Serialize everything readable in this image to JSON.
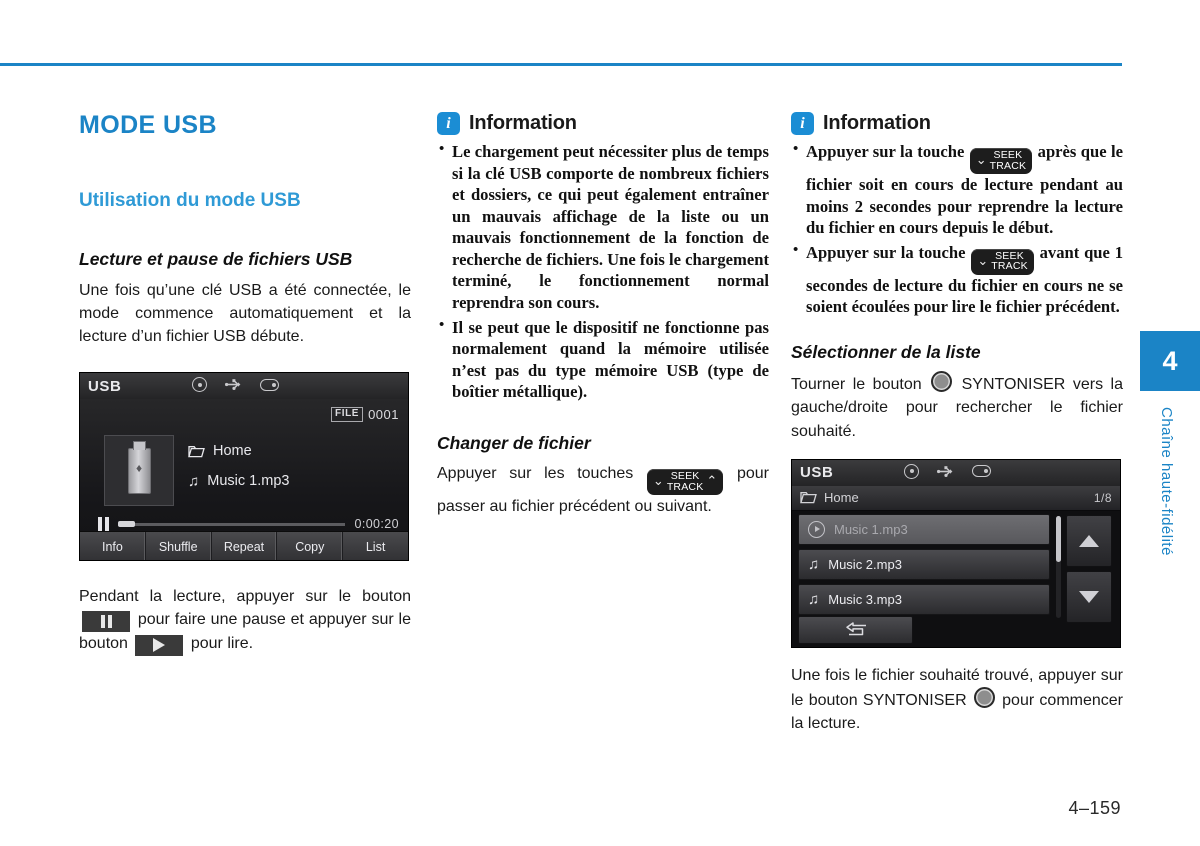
{
  "page": {
    "number": "4–159",
    "accent_color": "#1b84c6"
  },
  "side_tab": {
    "chapter_number": "4",
    "chapter_label": "Chaîne haute-fidélité"
  },
  "left_column": {
    "mode_title": "MODE USB",
    "section_title": "Utilisation du mode USB",
    "subsection_title": "Lecture et pause de fichiers USB",
    "intro_paragraph": "Une fois qu’une clé USB a été connectée, le mode commence automatiquement et la lecture d’un fichier USB débute.",
    "after_paragraph_1": "Pendant la lecture, appuyer sur le bouton",
    "after_paragraph_2": "pour faire une pause et appuyer sur le bouton",
    "after_paragraph_3": "pour lire."
  },
  "player_screen": {
    "source_label": "USB",
    "icons": [
      "disc-icon",
      "usb-icon",
      "aux-device-icon"
    ],
    "file_tag": "FILE",
    "file_number": "0001",
    "folder_name": "Home",
    "track_name": "Music 1.mp3",
    "elapsed_time": "0:00:20",
    "transport_state": "pause-icon",
    "soft_keys": [
      "Info",
      "Shuffle",
      "Repeat",
      "Copy",
      "List"
    ]
  },
  "middle_column": {
    "info_title": "Information",
    "info_items": [
      "Le chargement peut nécessiter plus de temps si la clé USB comporte de nombreux fichiers et dossiers, ce qui peut également entraîner un mauvais affichage de la liste ou un mauvais fonctionnement de la fonction de recherche de fichiers. Une fois le chargement terminé, le fonctionnement normal reprendra son cours.",
      "Il se peut que le dispositif ne fonctionne pas normalement quand la mémoire utilisée n’est pas du type mémoire USB (type de boîtier métallique)."
    ],
    "change_file_title": "Changer de fichier",
    "change_file_text_1": "Appuyer sur les touches",
    "change_file_text_2": "pour passer au fichier précédent ou suivant."
  },
  "right_column": {
    "info_title": "Information",
    "info_item_1_before": "Appuyer sur la touche",
    "info_item_1_after": "après que le fichier soit en cours de lecture pendant au moins 2 secondes pour reprendre la lecture du fichier en cours depuis le début.",
    "info_item_2_before": "Appuyer sur la touche",
    "info_item_2_after": "avant que 1 secondes de lecture du fichier en cours ne se soient écoulées pour lire le fichier précédent.",
    "select_list_title": "Sélectionner de la liste",
    "select_list_text_1": "Tourner le bouton",
    "select_list_text_2": "SYNTONISER vers la gauche/droite pour rechercher le fichier souhaité.",
    "after_list_text_1": "Une fois le fichier souhaité trouvé, appuyer sur le bouton SYNTONISER",
    "after_list_text_2": "pour commencer la lecture."
  },
  "list_screen": {
    "source_label": "USB",
    "breadcrumb_folder": "Home",
    "page_indicator": "1/8",
    "rows": [
      {
        "label": "Music 1.mp3",
        "icon": "play-circle-icon",
        "state": "playing"
      },
      {
        "label": "Music 2.mp3",
        "icon": "music-note-icon",
        "state": "normal"
      },
      {
        "label": "Music 3.mp3",
        "icon": "music-note-icon",
        "state": "normal"
      }
    ],
    "scroll_up": "up-arrow-icon",
    "scroll_down": "down-arrow-icon",
    "back_button": "back-icon"
  },
  "keys": {
    "seek": "SEEK",
    "track": "TRACK",
    "chevron_left": "⌄",
    "chevron_right": "⌃"
  }
}
